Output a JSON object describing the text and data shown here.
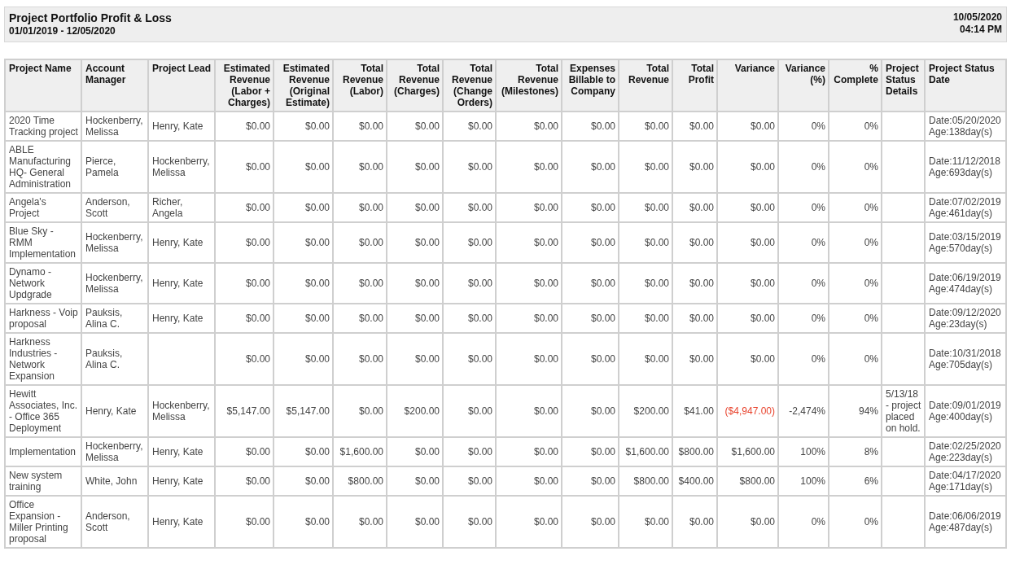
{
  "report": {
    "title": "Project Portfolio Profit & Loss",
    "date_range": "01/01/2019 - 12/05/2020",
    "run_date": "10/05/2020",
    "run_time": "04:14 PM"
  },
  "table": {
    "columns": [
      "Project Name",
      "Account Manager",
      "Project Lead",
      "Estimated Revenue (Labor + Charges)",
      "Estimated Revenue (Original Estimate)",
      "Total Revenue (Labor)",
      "Total Revenue (Charges)",
      "Total Revenue (Change Orders)",
      "Total Revenue (Milestones)",
      "Expenses Billable to Company",
      "Total Revenue",
      "Total Profit",
      "Variance",
      "Variance (%)",
      "% Complete",
      "Project Status Details",
      "Project Status Date"
    ],
    "rows": [
      {
        "negative_variance": false,
        "cells": [
          "2020 Time Tracking project",
          "Hockenberry, Melissa",
          "Henry, Kate",
          "$0.00",
          "$0.00",
          "$0.00",
          "$0.00",
          "$0.00",
          "$0.00",
          "$0.00",
          "$0.00",
          "$0.00",
          "$0.00",
          "0%",
          "0%",
          "",
          "Date:05/20/2020 Age:138day(s)"
        ]
      },
      {
        "negative_variance": false,
        "cells": [
          "ABLE Manufacturing HQ- General Administration",
          "Pierce, Pamela",
          "Hockenberry, Melissa",
          "$0.00",
          "$0.00",
          "$0.00",
          "$0.00",
          "$0.00",
          "$0.00",
          "$0.00",
          "$0.00",
          "$0.00",
          "$0.00",
          "0%",
          "0%",
          "",
          "Date:11/12/2018 Age:693day(s)"
        ]
      },
      {
        "negative_variance": false,
        "cells": [
          "Angela's Project",
          "Anderson, Scott",
          "Richer, Angela",
          "$0.00",
          "$0.00",
          "$0.00",
          "$0.00",
          "$0.00",
          "$0.00",
          "$0.00",
          "$0.00",
          "$0.00",
          "$0.00",
          "0%",
          "0%",
          "",
          "Date:07/02/2019 Age:461day(s)"
        ]
      },
      {
        "negative_variance": false,
        "cells": [
          "Blue Sky - RMM Implementation",
          "Hockenberry, Melissa",
          "Henry, Kate",
          "$0.00",
          "$0.00",
          "$0.00",
          "$0.00",
          "$0.00",
          "$0.00",
          "$0.00",
          "$0.00",
          "$0.00",
          "$0.00",
          "0%",
          "0%",
          "",
          "Date:03/15/2019 Age:570day(s)"
        ]
      },
      {
        "negative_variance": false,
        "cells": [
          "Dynamo - Network Updgrade",
          "Hockenberry, Melissa",
          "Henry, Kate",
          "$0.00",
          "$0.00",
          "$0.00",
          "$0.00",
          "$0.00",
          "$0.00",
          "$0.00",
          "$0.00",
          "$0.00",
          "$0.00",
          "0%",
          "0%",
          "",
          "Date:06/19/2019 Age:474day(s)"
        ]
      },
      {
        "negative_variance": false,
        "cells": [
          "Harkness - Voip proposal",
          "Pauksis, Alina C.",
          "Henry, Kate",
          "$0.00",
          "$0.00",
          "$0.00",
          "$0.00",
          "$0.00",
          "$0.00",
          "$0.00",
          "$0.00",
          "$0.00",
          "$0.00",
          "0%",
          "0%",
          "",
          "Date:09/12/2020 Age:23day(s)"
        ]
      },
      {
        "negative_variance": false,
        "cells": [
          "Harkness Industries - Network Expansion",
          "Pauksis, Alina C.",
          "",
          "$0.00",
          "$0.00",
          "$0.00",
          "$0.00",
          "$0.00",
          "$0.00",
          "$0.00",
          "$0.00",
          "$0.00",
          "$0.00",
          "0%",
          "0%",
          "",
          "Date:10/31/2018 Age:705day(s)"
        ]
      },
      {
        "negative_variance": true,
        "cells": [
          "Hewitt Associates, Inc. - Office 365 Deployment",
          "Henry, Kate",
          "Hockenberry, Melissa",
          "$5,147.00",
          "$5,147.00",
          "$0.00",
          "$200.00",
          "$0.00",
          "$0.00",
          "$0.00",
          "$200.00",
          "$41.00",
          "($4,947.00)",
          "-2,474%",
          "94%",
          "5/13/18 - project placed on hold.",
          "Date:09/01/2019 Age:400day(s)"
        ]
      },
      {
        "negative_variance": false,
        "cells": [
          "Implementation",
          "Hockenberry, Melissa",
          "Henry, Kate",
          "$0.00",
          "$0.00",
          "$1,600.00",
          "$0.00",
          "$0.00",
          "$0.00",
          "$0.00",
          "$1,600.00",
          "$800.00",
          "$1,600.00",
          "100%",
          "8%",
          "",
          "Date:02/25/2020 Age:223day(s)"
        ]
      },
      {
        "negative_variance": false,
        "cells": [
          "New system training",
          "White, John",
          "Henry, Kate",
          "$0.00",
          "$0.00",
          "$800.00",
          "$0.00",
          "$0.00",
          "$0.00",
          "$0.00",
          "$800.00",
          "$400.00",
          "$800.00",
          "100%",
          "6%",
          "",
          "Date:04/17/2020 Age:171day(s)"
        ]
      },
      {
        "negative_variance": false,
        "cells": [
          "Office Expansion - Miller Printing proposal",
          "Anderson, Scott",
          "Henry, Kate",
          "$0.00",
          "$0.00",
          "$0.00",
          "$0.00",
          "$0.00",
          "$0.00",
          "$0.00",
          "$0.00",
          "$0.00",
          "$0.00",
          "0%",
          "0%",
          "",
          "Date:06/06/2019 Age:487day(s)"
        ]
      }
    ]
  }
}
